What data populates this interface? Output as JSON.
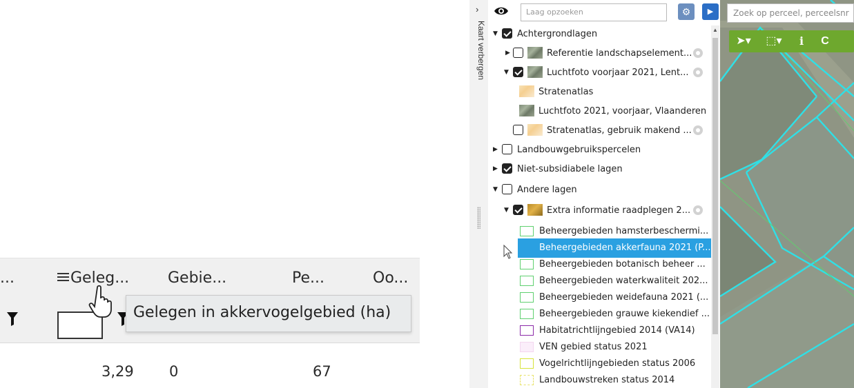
{
  "table": {
    "columns": [
      "...",
      "Geleg...",
      "Gebie...",
      "Pe...",
      "Oo..."
    ],
    "row_values": [
      "3,29",
      "0",
      "67"
    ],
    "tooltip": "Gelegen in akkervogelgebied (ha)"
  },
  "side_strip": {
    "label": "Kaart verbergen"
  },
  "layers_panel": {
    "search_placeholder": "Laag opzoeken",
    "items": [
      {
        "label": "Achtergrondlagen",
        "checked": true,
        "expanded": true
      },
      {
        "label": "Referentie landschapselement...",
        "checked": false,
        "expanded": false
      },
      {
        "label": "Luchtfoto voorjaar 2021, Lent...",
        "checked": true,
        "expanded": true
      },
      {
        "label": "Stratenatlas"
      },
      {
        "label": "Luchtfoto 2021, voorjaar, Vlaanderen"
      },
      {
        "label": "Stratenatlas, gebruik makend ...",
        "checked": false
      },
      {
        "label": "Landbouwgebruikspercelen",
        "checked": false,
        "expanded": false
      },
      {
        "label": "Niet-subsidiabele lagen",
        "checked": true,
        "expanded": false
      },
      {
        "label": "Andere lagen",
        "checked": false,
        "expanded": true
      },
      {
        "label": "Extra informatie raadplegen 2...",
        "checked": true,
        "expanded": true
      },
      {
        "label": "Beheergebieden hamsterbeschermi...",
        "swatch": "#5fd06f"
      },
      {
        "label": "Beheergebieden akkerfauna 2021 (P...",
        "swatch": "#2aa0e1",
        "selected": true
      },
      {
        "label": "Beheergebieden botanisch beheer ...",
        "swatch": "#5fd06f"
      },
      {
        "label": "Beheergebieden waterkwaliteit 202...",
        "swatch": "#5fd06f"
      },
      {
        "label": "Beheergebieden weidefauna 2021 (...",
        "swatch": "#5fd06f"
      },
      {
        "label": "Beheergebieden grauwe kiekendief ...",
        "swatch": "#5fd06f"
      },
      {
        "label": "Habitatrichtlijngebied 2014 (VA14)",
        "swatch": "#8b2aa8"
      },
      {
        "label": "VEN gebied status 2021",
        "swatch": "#f3d6ef"
      },
      {
        "label": "Vogelrichtlijngebieden status 2006",
        "swatch": "#d7e33a"
      },
      {
        "label": "Landbouwstreken status 2014",
        "swatch": "#e8e36a"
      }
    ]
  },
  "map": {
    "search_placeholder": "Zoek op perceel, perceelsnr",
    "tools": [
      "select-pointer",
      "draw-polygon",
      "info",
      "snap"
    ]
  },
  "colors": {
    "accent": "#2aa0e1",
    "toolbar": "#6ea82e",
    "parcel_outline": "#2fe0e6"
  }
}
